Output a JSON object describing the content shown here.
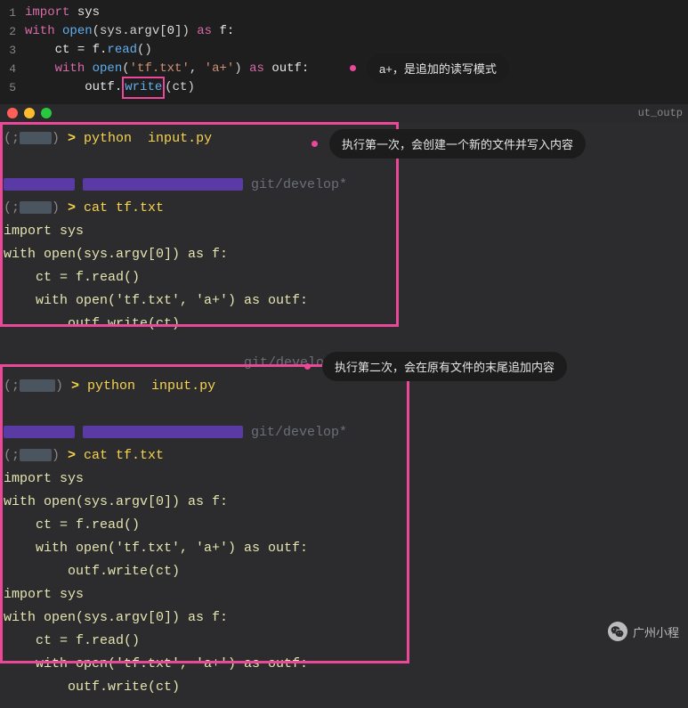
{
  "editor": {
    "lines": [
      {
        "n": "1",
        "indent": "",
        "parts": [
          {
            "t": "import ",
            "c": "kw"
          },
          {
            "t": "sys",
            "c": "var"
          }
        ]
      },
      {
        "n": "2",
        "indent": "",
        "parts": [
          {
            "t": "with ",
            "c": "kw"
          },
          {
            "t": "open",
            "c": "fn"
          },
          {
            "t": "(sys.argv[",
            "c": "op"
          },
          {
            "t": "0",
            "c": "var"
          },
          {
            "t": "]) ",
            "c": "op"
          },
          {
            "t": "as ",
            "c": "kw"
          },
          {
            "t": "f:",
            "c": "var"
          }
        ]
      },
      {
        "n": "3",
        "indent": "    ",
        "parts": [
          {
            "t": "ct = f.",
            "c": "var"
          },
          {
            "t": "read",
            "c": "fn"
          },
          {
            "t": "()",
            "c": "op"
          }
        ]
      },
      {
        "n": "4",
        "indent": "    ",
        "parts": [
          {
            "t": "with ",
            "c": "kw"
          },
          {
            "t": "open",
            "c": "fn"
          },
          {
            "t": "(",
            "c": "op"
          },
          {
            "t": "'tf.txt'",
            "c": "str"
          },
          {
            "t": ", ",
            "c": "op"
          },
          {
            "t": "'a+'",
            "c": "str"
          },
          {
            "t": ") ",
            "c": "op"
          },
          {
            "t": "as ",
            "c": "kw"
          },
          {
            "t": "outf:",
            "c": "var"
          }
        ]
      },
      {
        "n": "5",
        "indent": "        ",
        "parts": [
          {
            "t": "outf.",
            "c": "var"
          },
          {
            "t": "write",
            "c": "fn",
            "boxed": true
          },
          {
            "t": "(ct)",
            "c": "op"
          }
        ]
      }
    ]
  },
  "titlebar": {
    "right_text": "ut_outp"
  },
  "annotations": {
    "a1": "a+，是追加的读写模式",
    "a2": "执行第一次，会创建一个新的文件并写入内容",
    "a3": "执行第二次，会在原有文件的末尾追加内容"
  },
  "terminal1": {
    "prompt1": "python  input.py",
    "git": "git/develop*",
    "prompt2": "cat tf.txt",
    "output": [
      "import sys",
      "with open(sys.argv[0]) as f:",
      "    ct = f.read()",
      "    with open('tf.txt', 'a+') as outf:",
      "        outf.write(ct)"
    ]
  },
  "terminal2": {
    "git0": "git/develop*",
    "prompt1": "python  input.py",
    "git": "git/develop*",
    "prompt2": "cat tf.txt",
    "output": [
      "import sys",
      "with open(sys.argv[0]) as f:",
      "    ct = f.read()",
      "    with open('tf.txt', 'a+') as outf:",
      "        outf.write(ct)",
      "import sys",
      "with open(sys.argv[0]) as f:",
      "    ct = f.read()",
      "    with open('tf.txt', 'a+') as outf:",
      "        outf.write(ct)"
    ]
  },
  "wechat": {
    "label": "广州小程"
  }
}
